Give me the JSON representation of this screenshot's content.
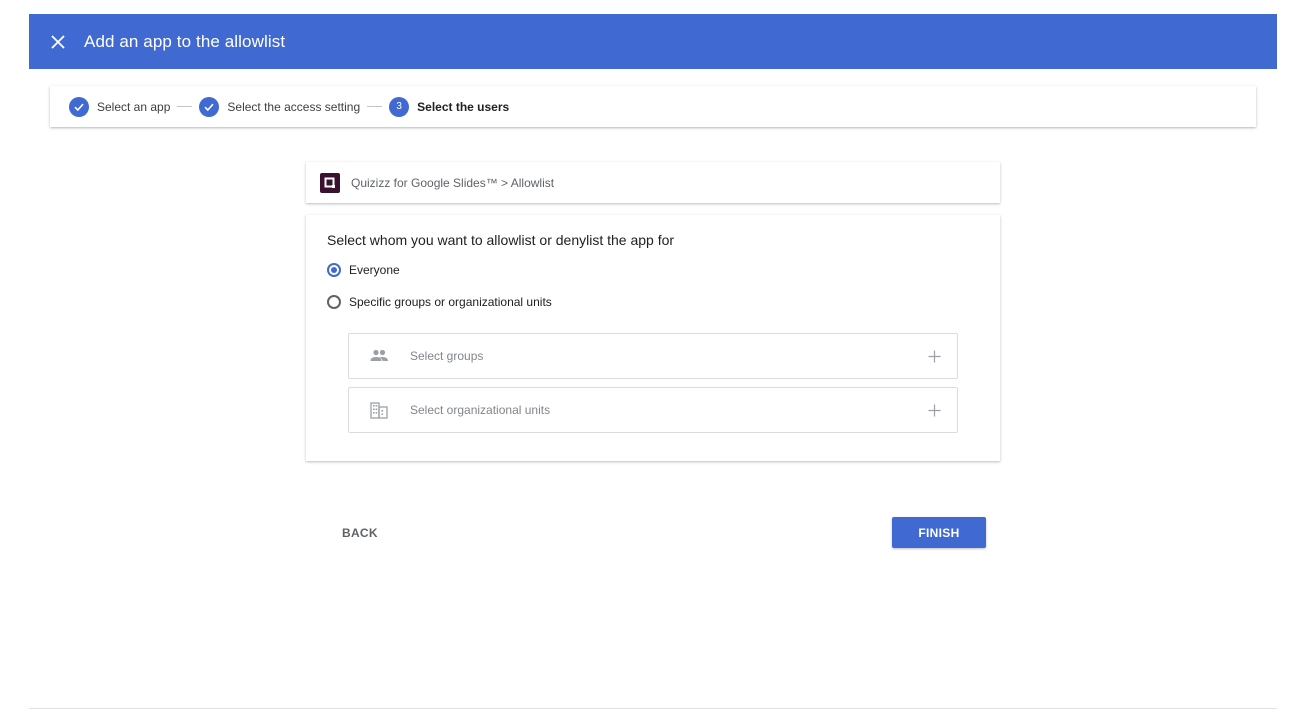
{
  "header": {
    "title": "Add an app to the allowlist",
    "close_icon": "close-icon",
    "color": "#4169d2"
  },
  "stepper": {
    "steps": [
      {
        "label": "Select an app",
        "state": "complete",
        "icon": "check-icon"
      },
      {
        "label": "Select the access setting",
        "state": "complete",
        "icon": "check-icon"
      },
      {
        "label": "Select the users",
        "state": "active",
        "number": "3"
      }
    ]
  },
  "app": {
    "logo_icon": "quizizz-logo",
    "breadcrumb": "Quizizz for Google Slides™ > Allowlist"
  },
  "audience": {
    "question": "Select whom you want to allowlist or denylist the app for",
    "options": [
      {
        "label": "Everyone",
        "selected": true
      },
      {
        "label": "Specific groups or organizational units",
        "selected": false
      }
    ],
    "groups": {
      "label": "Select groups",
      "icon": "people-icon",
      "action_icon": "plus-icon"
    },
    "org_units": {
      "label": "Select organizational units",
      "icon": "building-icon",
      "action_icon": "plus-icon"
    }
  },
  "footer": {
    "back_label": "BACK",
    "finish_label": "FINISH"
  }
}
